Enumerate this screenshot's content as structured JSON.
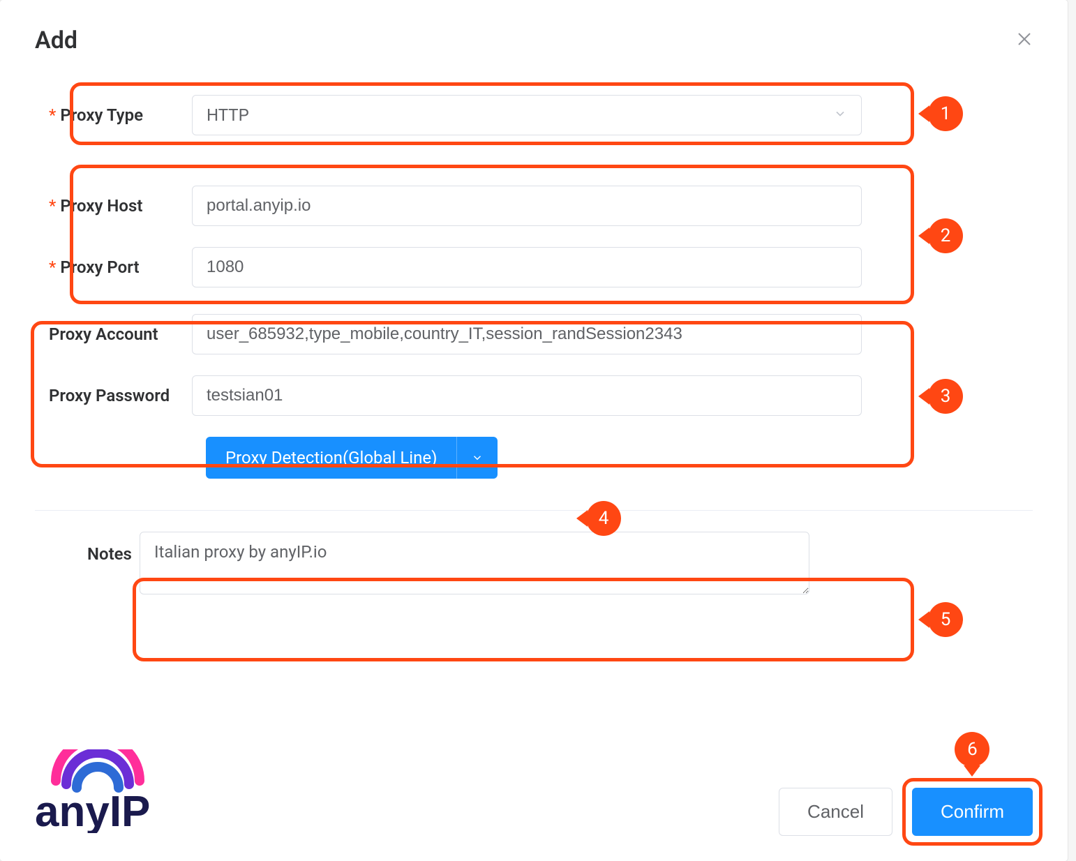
{
  "modal": {
    "title": "Add"
  },
  "form": {
    "proxyType": {
      "label": "Proxy Type",
      "value": "HTTP",
      "required": true
    },
    "proxyHost": {
      "label": "Proxy Host",
      "value": "portal.anyip.io",
      "required": true
    },
    "proxyPort": {
      "label": "Proxy Port",
      "value": "1080",
      "required": true
    },
    "proxyAccount": {
      "label": "Proxy Account",
      "value": "user_685932,type_mobile,country_IT,session_randSession2343",
      "required": false
    },
    "proxyPassword": {
      "label": "Proxy Password",
      "value": "testsian01",
      "required": false
    },
    "detectButton": "Proxy Detection(Global Line)",
    "notes": {
      "label": "Notes",
      "value": "Italian proxy by anyIP.io"
    }
  },
  "footer": {
    "logoText": "anyIP",
    "cancel": "Cancel",
    "confirm": "Confirm"
  },
  "annotations": [
    "1",
    "2",
    "3",
    "4",
    "5",
    "6"
  ]
}
